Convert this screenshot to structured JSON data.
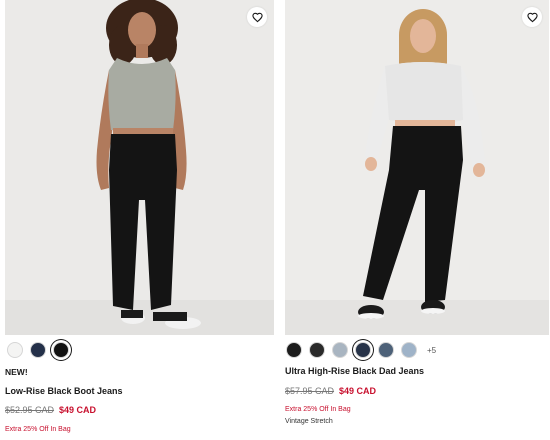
{
  "products": [
    {
      "badge": "NEW!",
      "name": "Low-Rise Black Boot Jeans",
      "original_price": "$52.95 CAD",
      "sale_price": "$49 CAD",
      "promo": "Extra 25% Off In Bag",
      "swatches": [
        {
          "color": "#f4f4f3",
          "selected": false
        },
        {
          "color": "#243049",
          "selected": false
        },
        {
          "color": "#111111",
          "selected": true
        }
      ]
    },
    {
      "name": "Ultra High-Rise Black Dad Jeans",
      "original_price": "$57.95 CAD",
      "sale_price": "$49 CAD",
      "promo": "Extra 25% Off In Bag",
      "feature": "Vintage Stretch",
      "more_colors": "+5",
      "swatches": [
        {
          "color": "#1c1c1c",
          "selected": false
        },
        {
          "color": "#2a2a2a",
          "selected": false
        },
        {
          "color": "#a9b5c1",
          "selected": false
        },
        {
          "color": "#273348",
          "selected": true
        },
        {
          "color": "#4d6178",
          "selected": false
        },
        {
          "color": "#9fb3c8",
          "selected": false
        }
      ]
    }
  ],
  "icons": {
    "wishlist": "heart-outline-icon"
  },
  "colors": {
    "sale": "#c8102e",
    "photo_bg": "#ecebe9"
  }
}
